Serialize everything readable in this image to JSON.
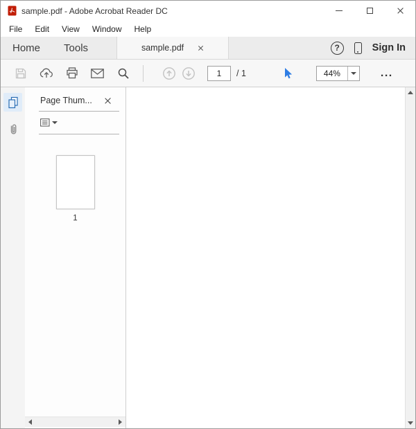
{
  "window": {
    "title": "sample.pdf - Adobe Acrobat Reader DC"
  },
  "menu": {
    "items": [
      {
        "label": "File"
      },
      {
        "label": "Edit"
      },
      {
        "label": "View"
      },
      {
        "label": "Window"
      },
      {
        "label": "Help"
      }
    ]
  },
  "tabbar": {
    "home_label": "Home",
    "tools_label": "Tools",
    "document_tab_label": "sample.pdf",
    "help_label": "?",
    "sign_in_label": "Sign In"
  },
  "toolbar": {
    "page_current": "1",
    "page_total_label": "/ 1",
    "zoom_value": "44%",
    "more_label": "..."
  },
  "thumbnails_panel": {
    "title": "Page Thum...",
    "page_label": "1"
  },
  "colors": {
    "accent_blue": "#2e7de4",
    "pdf_red": "#c11e07",
    "chrome_gray": "#ececec"
  }
}
